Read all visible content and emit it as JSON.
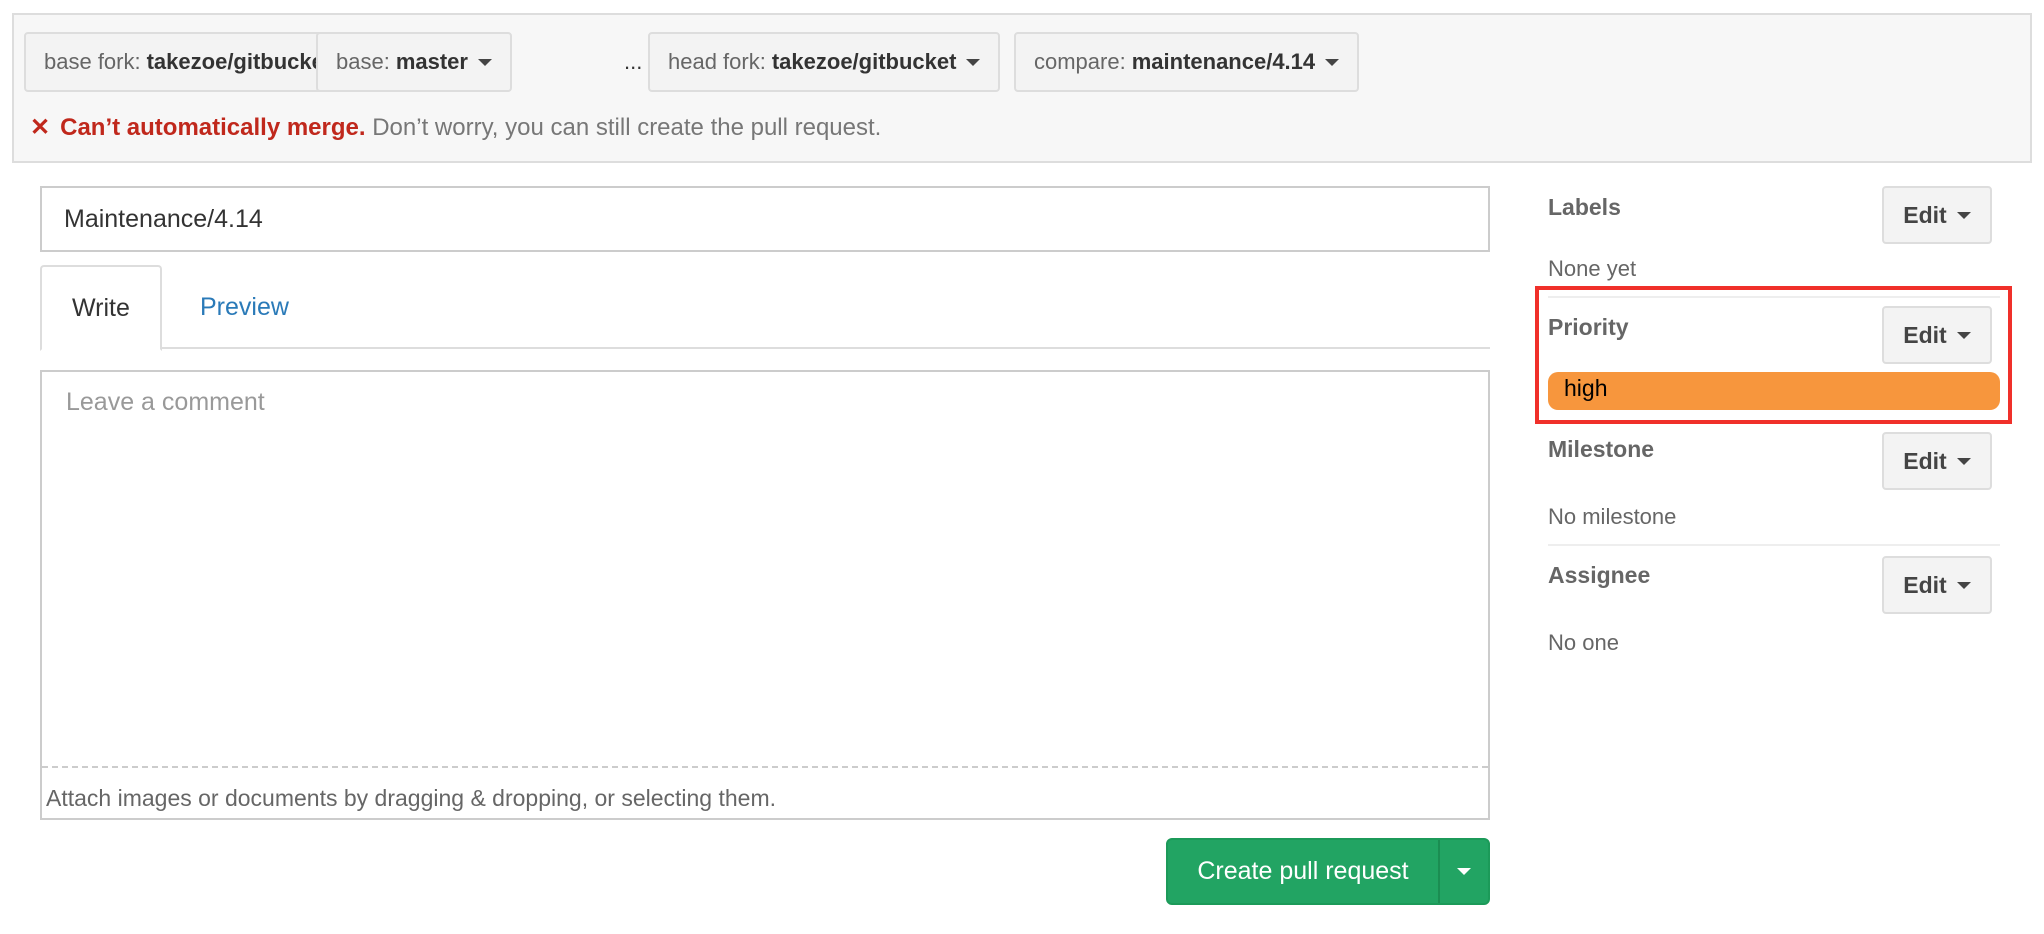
{
  "compare_bar": {
    "base_fork": {
      "label": "base fork:",
      "value": "takezoe/gitbucket"
    },
    "base": {
      "label": "base:",
      "value": "master"
    },
    "separator": "...",
    "head_fork": {
      "label": "head fork:",
      "value": "takezoe/gitbucket"
    },
    "compare": {
      "label": "compare:",
      "value": "maintenance/4.14"
    },
    "merge_status": {
      "icon": "x-icon",
      "symbol": "✕",
      "title": "Can’t automatically merge.",
      "message": "Don’t worry, you can still create the pull request."
    }
  },
  "form": {
    "title_value": "Maintenance/4.14",
    "tabs": [
      {
        "label": "Write",
        "active": true
      },
      {
        "label": "Preview",
        "active": false
      }
    ],
    "comment_placeholder": "Leave a comment",
    "attach_hint": "Attach images or documents by dragging & dropping, or selecting them.",
    "create_button": "Create pull request"
  },
  "sidebar": {
    "labels": {
      "title": "Labels",
      "edit": "Edit",
      "value": "None yet"
    },
    "priority": {
      "title": "Priority",
      "edit": "Edit",
      "value": "high",
      "color": "#f7963d",
      "highlight_color": "#f0302a"
    },
    "milestone": {
      "title": "Milestone",
      "edit": "Edit",
      "value": "No milestone"
    },
    "assignee": {
      "title": "Assignee",
      "edit": "Edit",
      "value": "No one"
    }
  },
  "colors": {
    "accent_green": "#22a463",
    "error_red": "#c0281c",
    "link_blue": "#2a7ab8"
  }
}
